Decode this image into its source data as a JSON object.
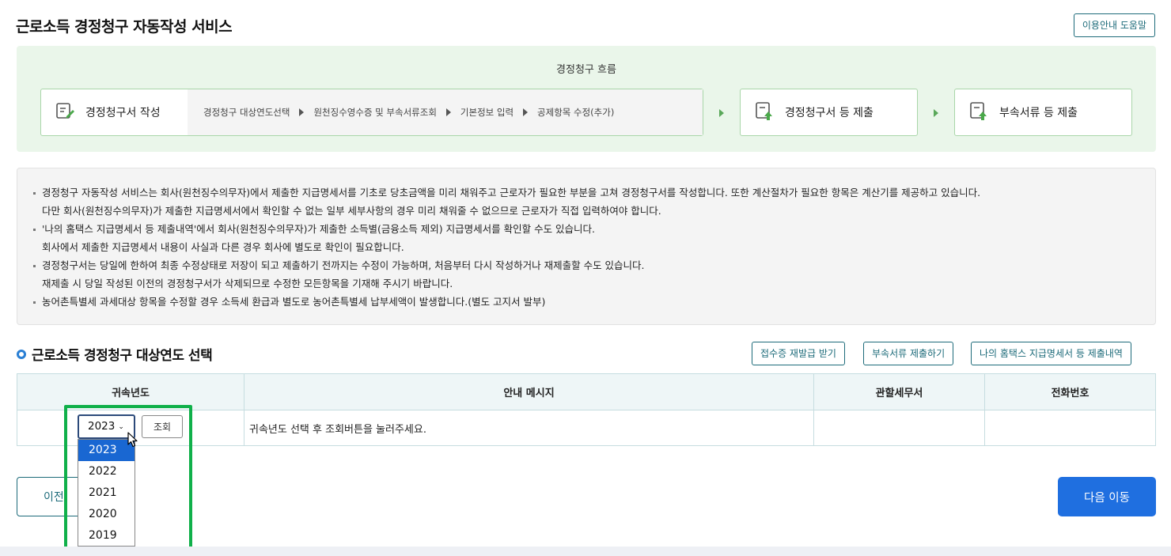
{
  "page": {
    "title": "근로소득 경정청구 자동작성 서비스",
    "help_button": "이용안내 도움말"
  },
  "flow": {
    "title": "경정청구 흐름",
    "step1": {
      "label": "경정청구서 작성",
      "icon": "form-edit-icon",
      "substeps": [
        "경정청구 대상연도선택",
        "원천징수영수증 및 부속서류조회",
        "기본정보 입력",
        "공제항목 수정(추가)"
      ]
    },
    "step2": {
      "label": "경정청구서 등 제출",
      "icon": "submit-upload-icon"
    },
    "step3": {
      "label": "부속서류 등 제출",
      "icon": "submit-upload-icon"
    }
  },
  "notices": [
    {
      "line1": "경정청구 자동작성 서비스는 회사(원천징수의무자)에서 제출한 지급명세서를 기초로 당초금액을 미리 채워주고 근로자가 필요한 부분을 고쳐 경정청구서를 작성합니다. 또한 계산절차가 필요한 항목은 계산기를 제공하고 있습니다.",
      "line2": "다만 회사(원천징수의무자)가 제출한 지급명세서에서 확인할 수 없는 일부 세부사항의 경우 미리 채워줄 수 없으므로 근로자가 직접 입력하여야 합니다."
    },
    {
      "line1": "'나의 홈택스 지급명세서 등 제출내역'에서 회사(원천징수의무자)가 제출한 소득별(금융소득 제외) 지급명세서를 확인할 수도 있습니다.",
      "line2": "회사에서 제출한 지급명세서 내용이 사실과 다른 경우 회사에 별도로 확인이 필요합니다."
    },
    {
      "line1": "경정청구서는 당일에 한하여 최종 수정상태로 저장이 되고 제출하기 전까지는 수정이 가능하며, 처음부터 다시 작성하거나 재제출할 수도 있습니다.",
      "line2": "재제출 시 당일 작성된 이전의 경정청구서가 삭제되므로 수정한 모든항목을 기재해 주시기 바랍니다."
    },
    {
      "line1": "농어촌특별세 과세대상 항목을 수정할 경우 소득세 환급과 별도로 농어촌특별세 납부세액이 발생합니다.(별도 고지서 발부)"
    }
  ],
  "section": {
    "title": "근로소득 경정청구 대상연도 선택",
    "buttons": {
      "reissue": "접수증 재발급 받기",
      "attach": "부속서류 제출하기",
      "hometax": "나의 홈택스 지급명세서 등 제출내역"
    }
  },
  "table": {
    "headers": [
      "귀속년도",
      "안내 메시지",
      "관할세무서",
      "전화번호"
    ],
    "row": {
      "message": "귀속년도 선택 후 조회버튼을 눌러주세요.",
      "tax_office": "",
      "phone": ""
    }
  },
  "year_select": {
    "value": "2023",
    "options": [
      "2023",
      "2022",
      "2021",
      "2020",
      "2019"
    ],
    "selected_index": 0,
    "query_button": "조회"
  },
  "nav": {
    "prev": "이전",
    "next": "다음 이동"
  },
  "colors": {
    "flow_background": "#eaf6ea",
    "teal_border": "#1d6b7a",
    "primary_button": "#1f6fe0",
    "highlight_box": "#10b04a",
    "selected_option": "#1967d2"
  }
}
